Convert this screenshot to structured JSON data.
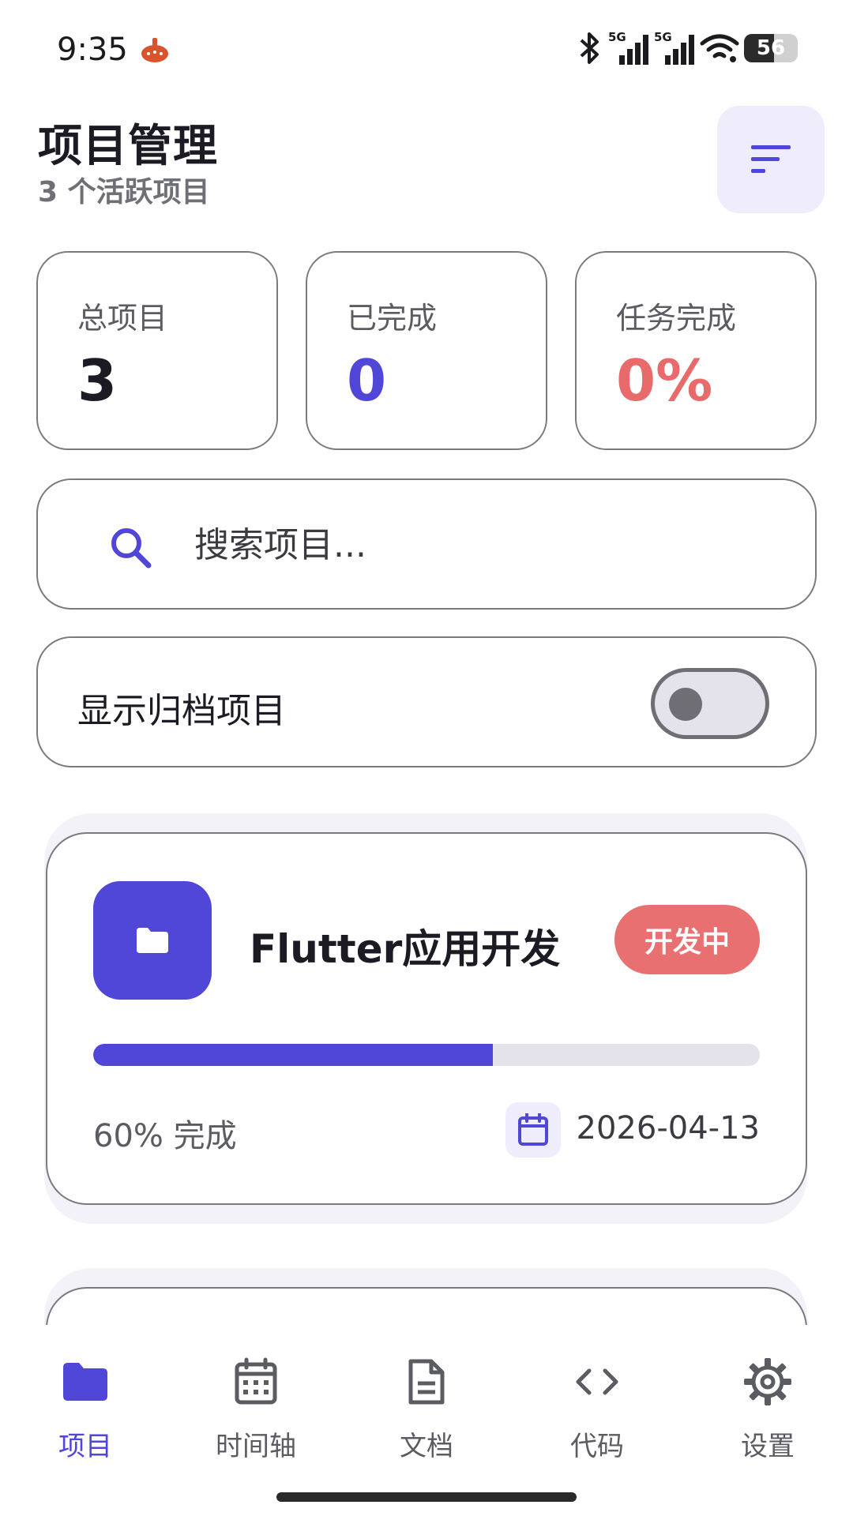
{
  "status_bar": {
    "time": "9:35",
    "network_1": "5G",
    "network_2": "5G",
    "battery": "56"
  },
  "header": {
    "title": "项目管理",
    "subtitle": "3 个活跃项目",
    "sort_icon": "sort-icon"
  },
  "stats": [
    {
      "label": "总项目",
      "value": "3",
      "color": "#1c1b24"
    },
    {
      "label": "已完成",
      "value": "0",
      "color": "#5046d8"
    },
    {
      "label": "任务完成",
      "value": "0%",
      "color": "#e86a6a"
    }
  ],
  "search": {
    "placeholder": "搜索项目...",
    "icon": "search-icon"
  },
  "archive": {
    "label": "显示归档项目",
    "enabled": false
  },
  "projects": [
    {
      "title": "Flutter应用开发",
      "status": "开发中",
      "status_color": "#e87070",
      "progress": 60,
      "progress_label": "60% 完成",
      "due_date": "2026-04-13",
      "icon": "folder-icon"
    }
  ],
  "bottom_nav": [
    {
      "label": "项目",
      "icon": "folder-icon",
      "active": true
    },
    {
      "label": "时间轴",
      "icon": "calendar-grid-icon",
      "active": false
    },
    {
      "label": "文档",
      "icon": "document-icon",
      "active": false
    },
    {
      "label": "代码",
      "icon": "code-icon",
      "active": false
    },
    {
      "label": "设置",
      "icon": "gear-icon",
      "active": false
    }
  ],
  "colors": {
    "accent": "#5046d8",
    "accent_soft": "#efedfb",
    "danger": "#e87070",
    "border": "#7a7a80",
    "muted_text": "#5b5b62"
  }
}
